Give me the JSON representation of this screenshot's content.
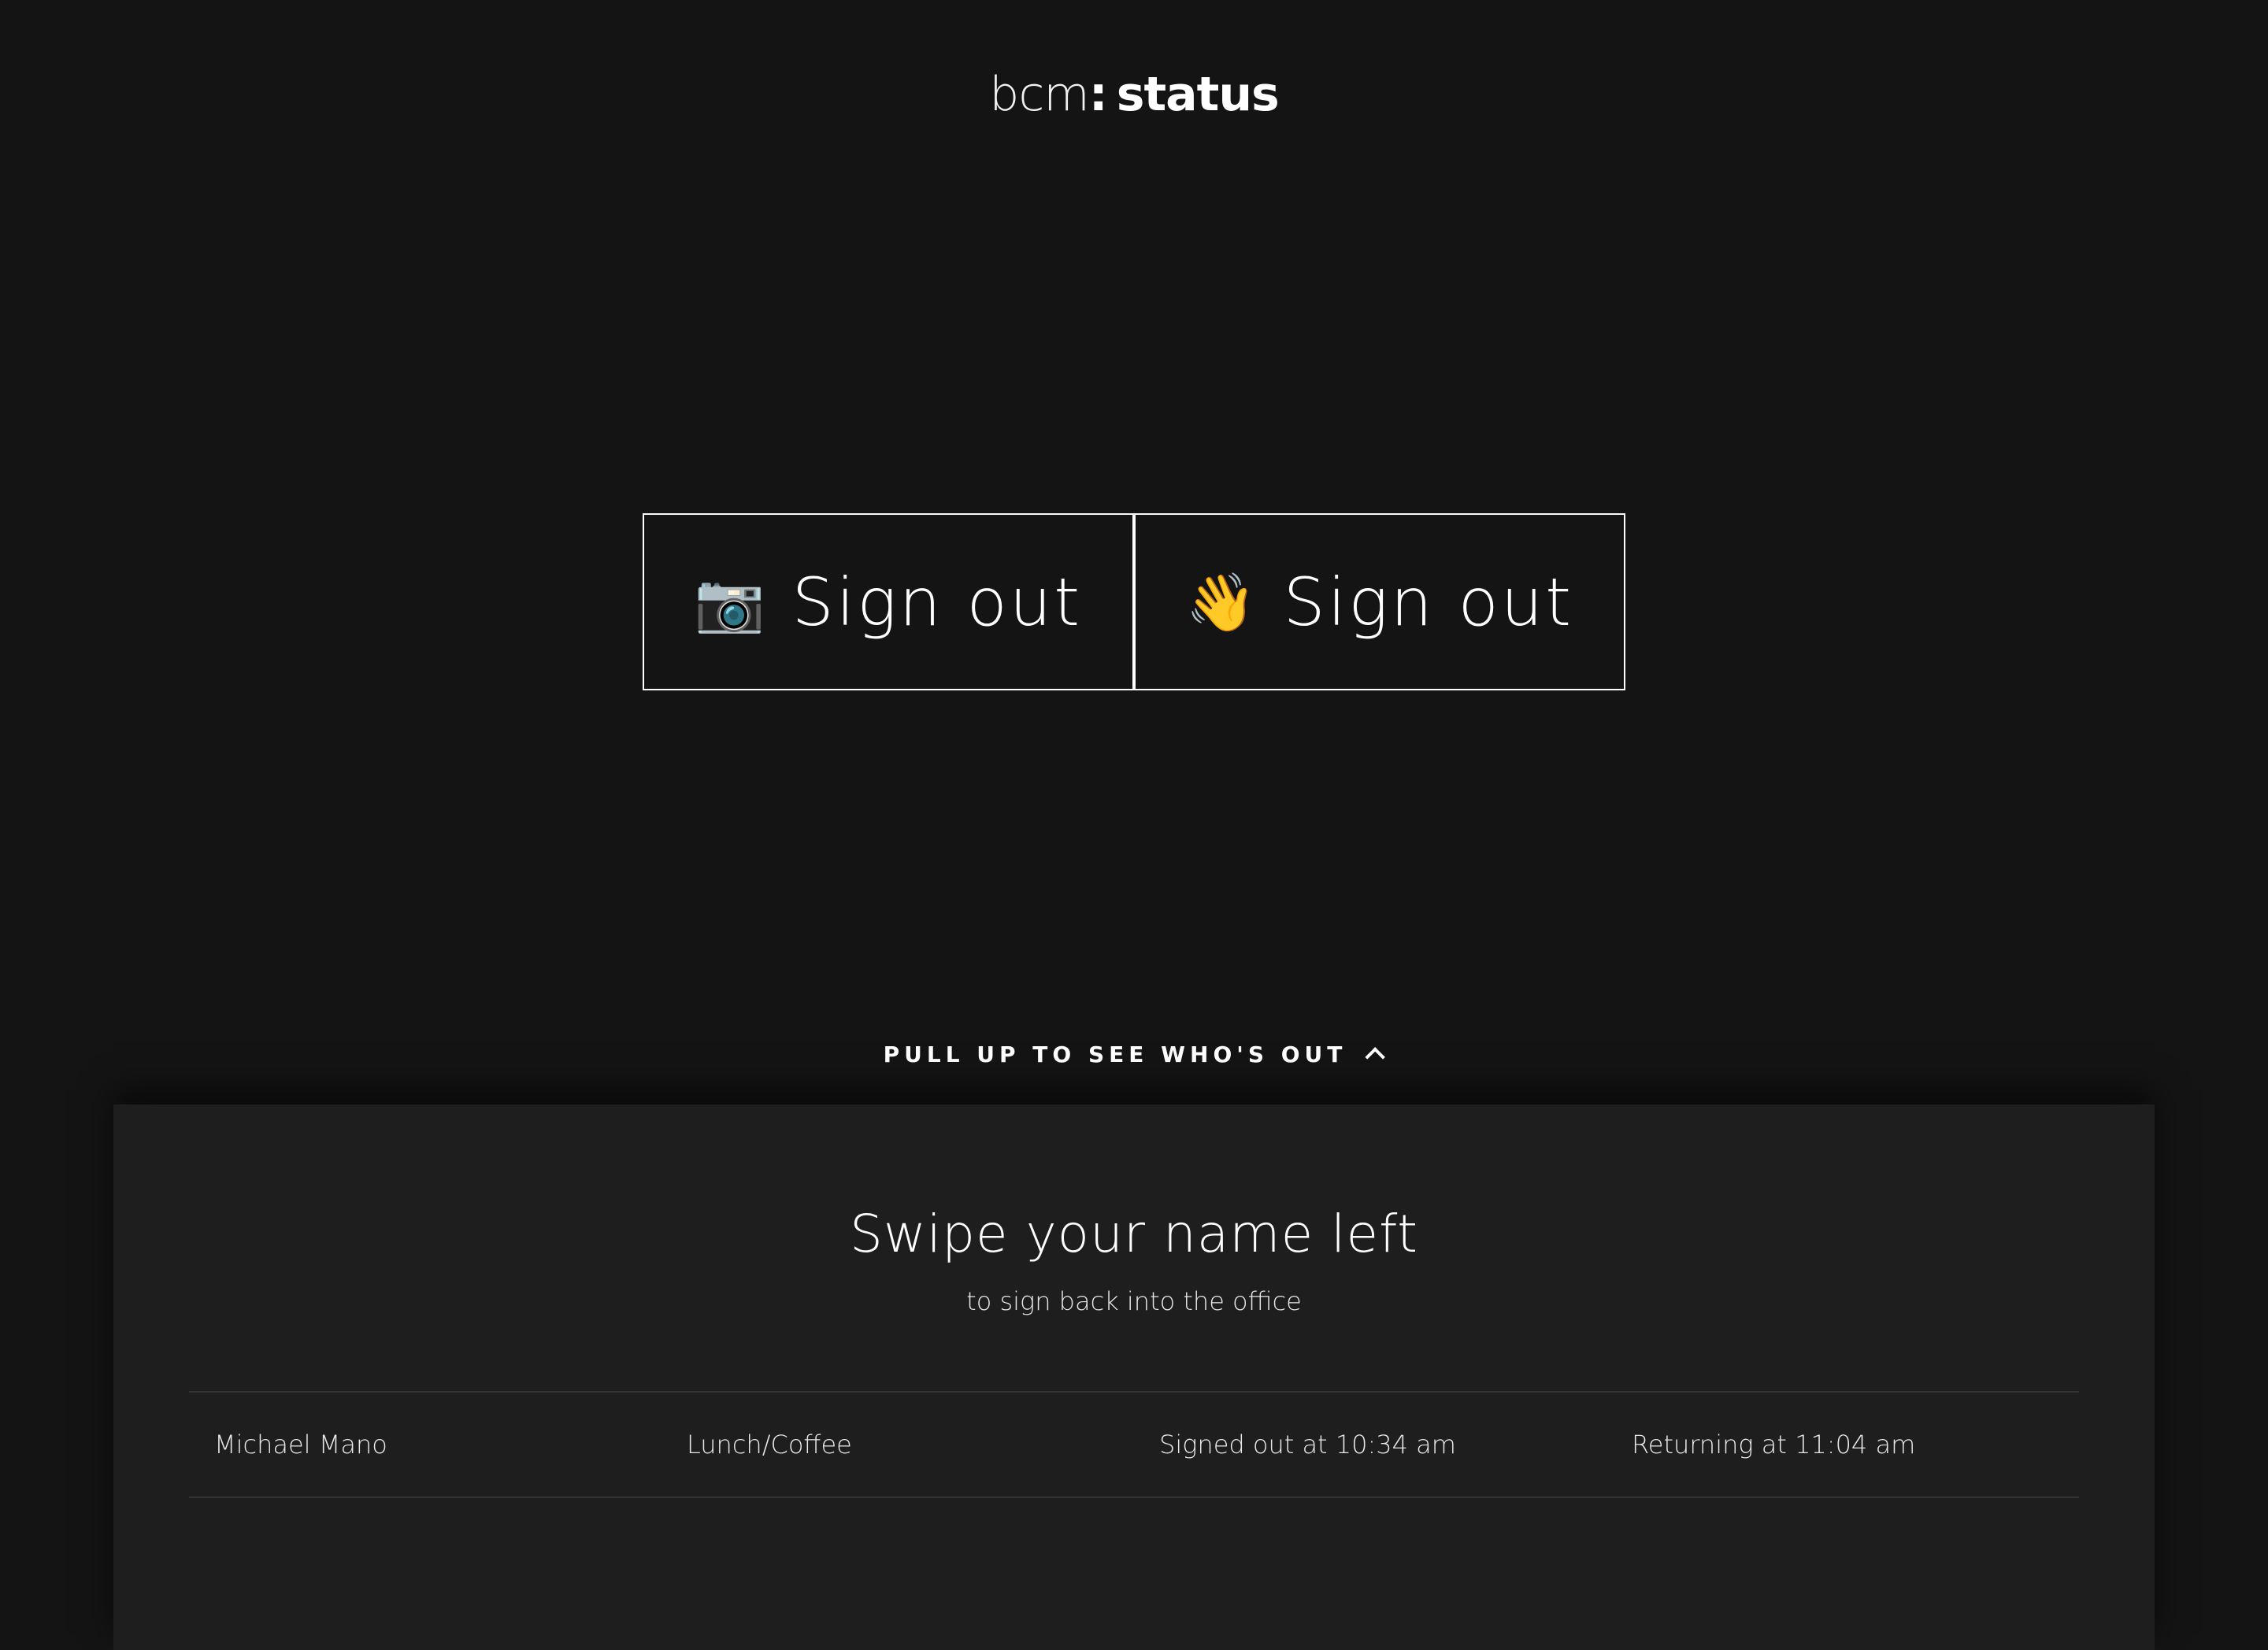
{
  "logo": {
    "brand": "bcm",
    "separator": ":",
    "word": "status"
  },
  "buttons": [
    {
      "icon": "camera-icon",
      "emoji": "📷",
      "label": "Sign out"
    },
    {
      "icon": "waving-hand-icon",
      "emoji": "👋",
      "label": "Sign out"
    }
  ],
  "pull_prompt": {
    "label": "PULL UP TO SEE WHO'S OUT",
    "icon": "chevron-up-icon"
  },
  "panel": {
    "title": "Swipe your name left",
    "subtitle": "to sign back into the office",
    "rows": [
      {
        "name": "Michael Mano",
        "reason": "Lunch/Coffee",
        "signed_out": "Signed out at 10:34 am",
        "returning": "Returning at 11:04 am"
      }
    ]
  },
  "colors": {
    "background": "#141414",
    "panel": "#1e1e1e",
    "text": "#ffffff",
    "divider": "#333333"
  }
}
